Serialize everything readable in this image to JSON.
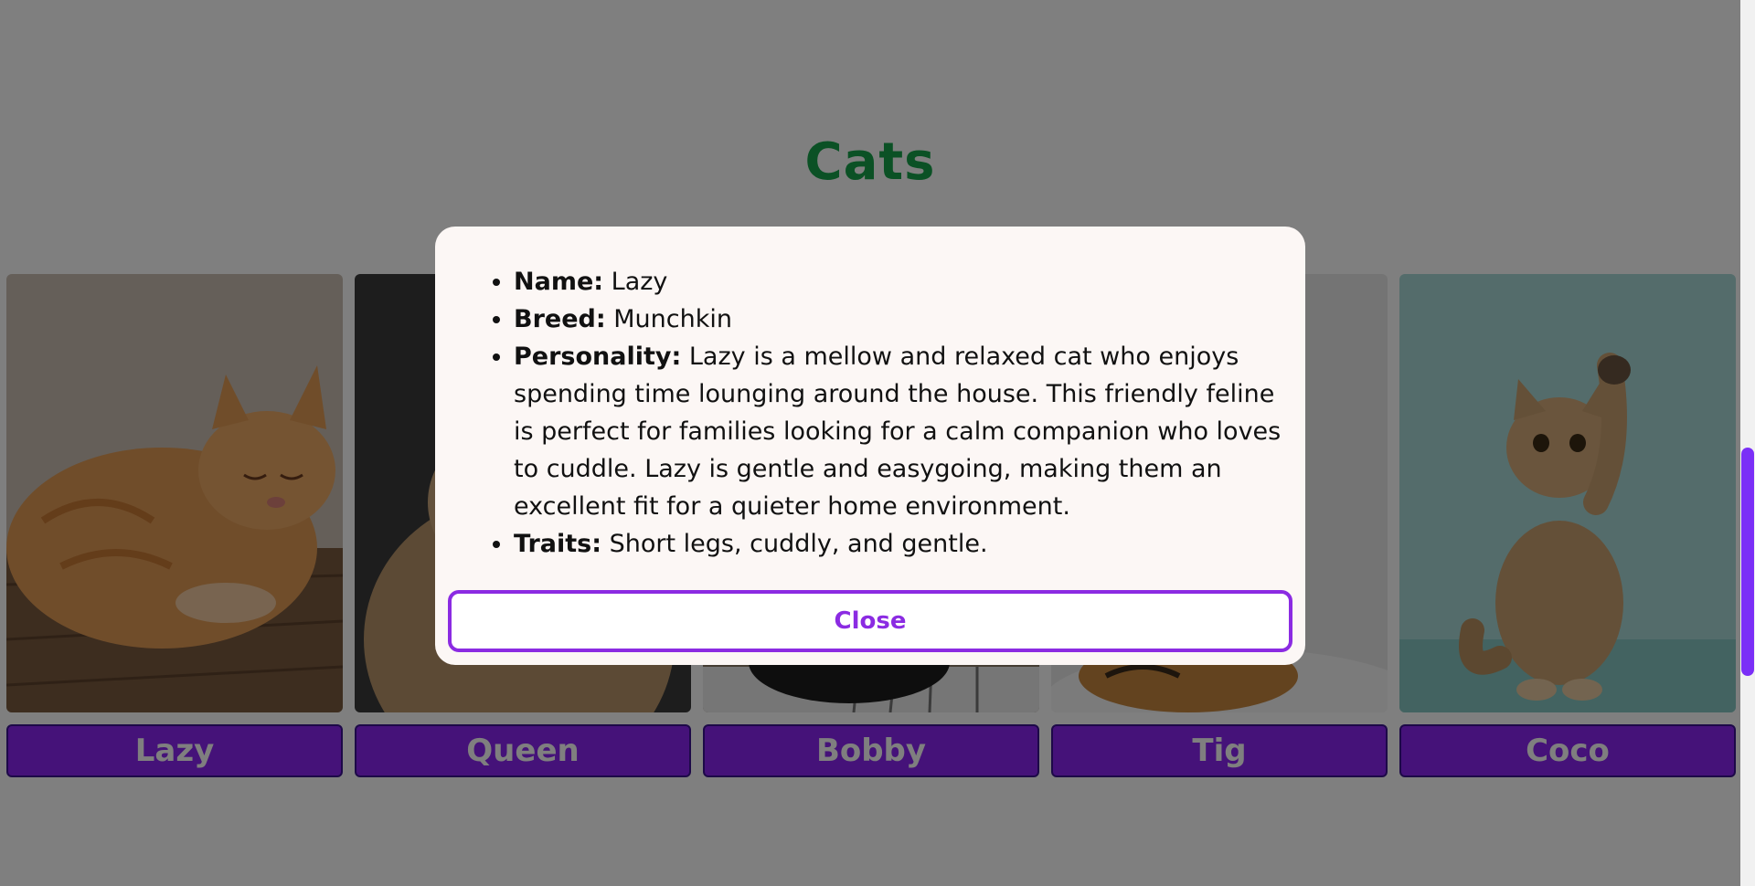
{
  "page": {
    "title": "Cats"
  },
  "cats": [
    {
      "name": "Lazy"
    },
    {
      "name": "Queen"
    },
    {
      "name": "Bobby"
    },
    {
      "name": "Tig"
    },
    {
      "name": "Coco"
    }
  ],
  "modal": {
    "name_label": "Name:",
    "name_value": "Lazy",
    "breed_label": "Breed:",
    "breed_value": "Munchkin",
    "personality_label": "Personality:",
    "personality_value": "Lazy is a mellow and relaxed cat who enjoys spending time lounging around the house. This friendly feline is perfect for families looking for a calm companion who loves to cuddle. Lazy is gentle and easygoing, making them an excellent fit for a quieter home environment.",
    "traits_label": "Traits:",
    "traits_value": "Short legs, cuddly, and gentle.",
    "close_label": "Close"
  },
  "colors": {
    "title": "#17a34a",
    "accent": "#8b2be2",
    "button_bg": "#8b24f2"
  }
}
